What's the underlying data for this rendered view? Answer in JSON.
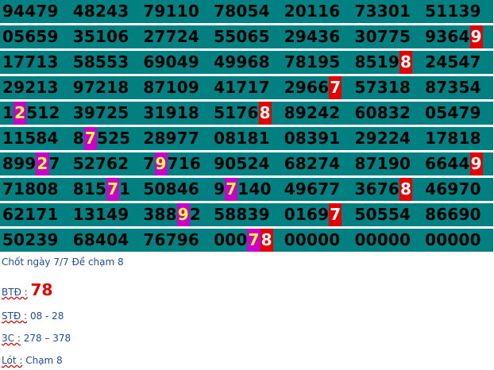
{
  "colors": {
    "row_background": "#008080",
    "highlight_red": "#e60000",
    "highlight_magenta": "#cc00cc",
    "highlight_magenta_text": "#ffff33",
    "note_text": "#1f4e99",
    "note_emphasis": "#e60000"
  },
  "rows": [
    [
      "94479",
      "48243",
      "79110",
      "78054",
      "20116",
      "73301",
      "51139"
    ],
    [
      "05659",
      "35106",
      "27724",
      "55065",
      "29436",
      "30775",
      "93649"
    ],
    [
      "17713",
      "58553",
      "69049",
      "49968",
      "78195",
      "85198",
      "24547"
    ],
    [
      "29213",
      "97218",
      "87109",
      "41717",
      "29667",
      "57318",
      "87354"
    ],
    [
      "12512",
      "39725",
      "31918",
      "51768",
      "89242",
      "60832",
      "05479"
    ],
    [
      "11584",
      "87525",
      "28977",
      "08181",
      "08391",
      "29224",
      "17818"
    ],
    [
      "89927",
      "52762",
      "79716",
      "90524",
      "68274",
      "87190",
      "66449"
    ],
    [
      "71808",
      "81571",
      "50846",
      "97140",
      "49677",
      "36768",
      "46970"
    ],
    [
      "62171",
      "13149",
      "38892",
      "58839",
      "01697",
      "50554",
      "86690"
    ],
    [
      "50239",
      "68404",
      "76796",
      "00078",
      "00000",
      "00000",
      "00000"
    ]
  ],
  "highlights": [
    {
      "row": 1,
      "col": 6,
      "pos": [
        4
      ],
      "style": "red"
    },
    {
      "row": 2,
      "col": 5,
      "pos": [
        4
      ],
      "style": "red"
    },
    {
      "row": 3,
      "col": 4,
      "pos": [
        4
      ],
      "style": "red"
    },
    {
      "row": 4,
      "col": 0,
      "pos": [
        1
      ],
      "style": "mag"
    },
    {
      "row": 4,
      "col": 3,
      "pos": [
        4
      ],
      "style": "red"
    },
    {
      "row": 5,
      "col": 1,
      "pos": [
        1
      ],
      "style": "mag"
    },
    {
      "row": 6,
      "col": 0,
      "pos": [
        3
      ],
      "style": "mag"
    },
    {
      "row": 6,
      "col": 2,
      "pos": [
        1
      ],
      "style": "mag"
    },
    {
      "row": 6,
      "col": 6,
      "pos": [
        4
      ],
      "style": "red"
    },
    {
      "row": 7,
      "col": 1,
      "pos": [
        3
      ],
      "style": "mag"
    },
    {
      "row": 7,
      "col": 3,
      "pos": [
        1
      ],
      "style": "mag"
    },
    {
      "row": 7,
      "col": 5,
      "pos": [
        4
      ],
      "style": "red"
    },
    {
      "row": 8,
      "col": 2,
      "pos": [
        3
      ],
      "style": "mag"
    },
    {
      "row": 8,
      "col": 4,
      "pos": [
        4
      ],
      "style": "red"
    },
    {
      "row": 9,
      "col": 3,
      "pos": [
        3
      ],
      "style": "mag"
    },
    {
      "row": 9,
      "col": 3,
      "pos": [
        4
      ],
      "style": "red"
    }
  ],
  "notes": {
    "line1": "Chốt ngày 7/7 Đề chạm 8",
    "btd_label": "BTĐ :",
    "btd_value": "78",
    "std_label": "STĐ :",
    "std_value": "08 - 28",
    "c3_label": "3C :",
    "c3_value": "278  – 378",
    "lot_label": "Lót :",
    "lot_value": "Chạm 8"
  }
}
